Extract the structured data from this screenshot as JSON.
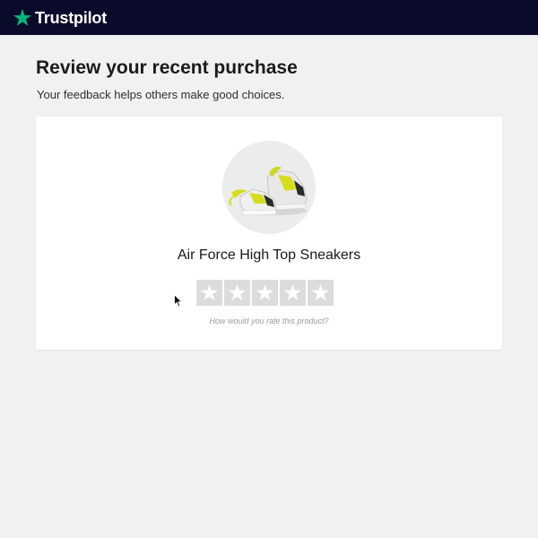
{
  "header": {
    "brand_name": "Trustpilot",
    "brand_icon": "star-icon",
    "brand_color": "#00b67a",
    "background": "#0a0a2a"
  },
  "page": {
    "title": "Review your recent purchase",
    "subtitle": "Your feedback helps others make good choices."
  },
  "product": {
    "name": "Air Force High Top Sneakers",
    "image_icon": "sneakers-image"
  },
  "rating": {
    "max_stars": 5,
    "selected": 0,
    "prompt": "How would you rate this product?",
    "star_icon": "star-icon",
    "empty_color": "#dcdcdc"
  }
}
